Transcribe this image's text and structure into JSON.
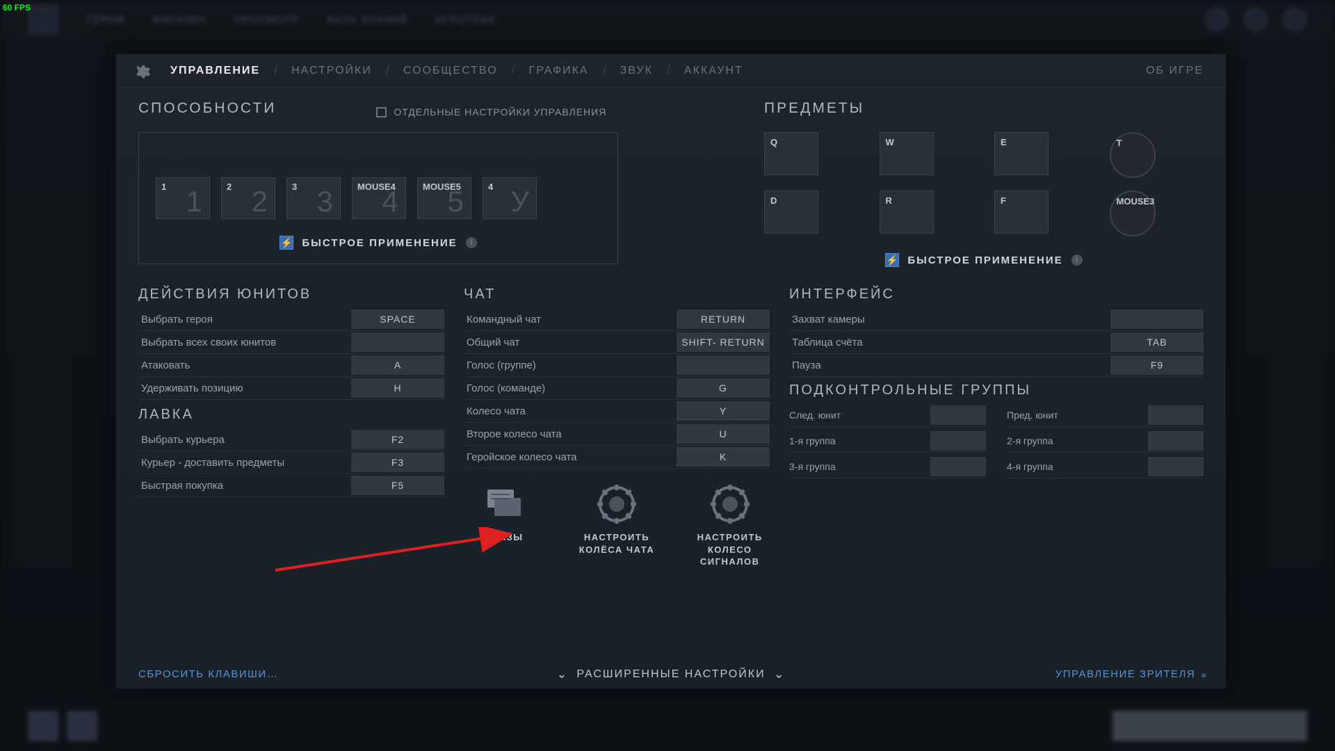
{
  "fps": "60 FPS",
  "topnav": [
    "ГЕРОИ",
    "МАГАЗИН",
    "ПРОСМОТР",
    "БАЗА ЗНАНИЙ",
    "ИГРОТЕКА"
  ],
  "tabs": {
    "controls": "УПРАВЛЕНИЕ",
    "options": "НАСТРОЙКИ",
    "social": "СООБЩЕСТВО",
    "graphics": "ГРАФИКА",
    "sound": "ЗВУК",
    "account": "АККАУНТ",
    "about": "ОБ ИГРЕ"
  },
  "abilities": {
    "title": "СПОСОБНОСТИ",
    "separate": "ОТДЕЛЬНЫЕ НАСТРОЙКИ УПРАВЛЕНИЯ",
    "slots": [
      {
        "key": "1",
        "big": "1"
      },
      {
        "key": "2",
        "big": "2"
      },
      {
        "key": "3",
        "big": "3"
      },
      {
        "key": "MOUSE4",
        "big": "4"
      },
      {
        "key": "MOUSE5",
        "big": "5"
      },
      {
        "key": "4",
        "big": "У"
      }
    ],
    "quick": "БЫСТРОЕ ПРИМЕНЕНИЕ"
  },
  "items": {
    "title": "ПРЕДМЕТЫ",
    "slots": [
      {
        "key": "Q"
      },
      {
        "key": "W"
      },
      {
        "key": "E"
      },
      {
        "key": "T",
        "circle": true
      },
      {
        "key": "D"
      },
      {
        "key": "R"
      },
      {
        "key": "F"
      },
      {
        "key": "MOUSE3",
        "circle": true
      }
    ],
    "quick": "БЫСТРОЕ ПРИМЕНЕНИЕ"
  },
  "units": {
    "title": "ДЕЙСТВИЯ ЮНИТОВ",
    "rows": [
      {
        "l": "Выбрать героя",
        "k": "SPACE"
      },
      {
        "l": "Выбрать всех своих юнитов",
        "k": ""
      },
      {
        "l": "Атаковать",
        "k": "A"
      },
      {
        "l": "Удерживать позицию",
        "k": "H"
      }
    ]
  },
  "shop": {
    "title": "ЛАВКА",
    "rows": [
      {
        "l": "Выбрать курьера",
        "k": "F2"
      },
      {
        "l": "Курьер - доставить предметы",
        "k": "F3"
      },
      {
        "l": "Быстрая покупка",
        "k": "F5"
      }
    ]
  },
  "chat": {
    "title": "ЧАТ",
    "rows": [
      {
        "l": "Командный чат",
        "k": "RETURN"
      },
      {
        "l": "Общий чат",
        "k": "SHIFT- RETURN"
      },
      {
        "l": "Голос (группе)",
        "k": ""
      },
      {
        "l": "Голос (команде)",
        "k": "G"
      },
      {
        "l": "Колесо чата",
        "k": "Y"
      },
      {
        "l": "Второе колесо чата",
        "k": "U"
      },
      {
        "l": "Геройское колесо чата",
        "k": "K"
      }
    ],
    "buttons": {
      "phrases": "ФРАЗЫ",
      "chatwheels": "НАСТРОИТЬ КОЛЁСА ЧАТА",
      "pingwheel": "НАСТРОИТЬ КОЛЕСО СИГНАЛОВ"
    }
  },
  "interface": {
    "title": "ИНТЕРФЕЙС",
    "rows": [
      {
        "l": "Захват камеры",
        "k": ""
      },
      {
        "l": "Таблица счёта",
        "k": "TAB"
      },
      {
        "l": "Пауза",
        "k": "F9"
      }
    ]
  },
  "groups": {
    "title": "ПОДКОНТРОЛЬНЫЕ ГРУППЫ",
    "rows": [
      {
        "l": "След. юнит"
      },
      {
        "l": "Пред. юнит"
      },
      {
        "l": "1-я группа"
      },
      {
        "l": "2-я группа"
      },
      {
        "l": "3-я группа"
      },
      {
        "l": "4-я группа"
      }
    ]
  },
  "footer": {
    "reset": "СБРОСИТЬ КЛАВИШИ…",
    "advanced": "РАСШИРЕННЫЕ НАСТРОЙКИ",
    "spectator": "УПРАВЛЕНИЕ ЗРИТЕЛЯ"
  }
}
